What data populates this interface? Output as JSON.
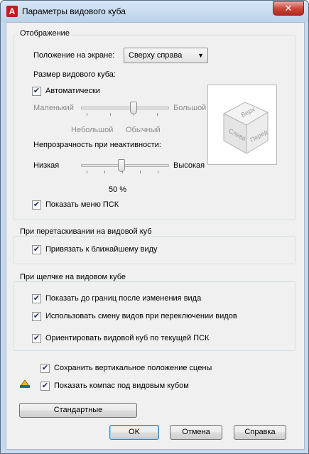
{
  "window": {
    "title": "Параметры видового куба",
    "app_icon_letter": "A",
    "close_glyph": "✕"
  },
  "display_group": {
    "title": "Отображение",
    "position_label": "Положение на экране:",
    "position_value": "Сверху справа",
    "size_label": "Размер видового куба:",
    "auto_label": "Автоматически",
    "auto_checked": true,
    "size_small": "Маленький",
    "size_large": "Большой",
    "size_smallish": "Небольшой",
    "size_normal": "Обычный",
    "size_level": 0.75,
    "opacity_label": "Непрозрачность при неактивности:",
    "opacity_low": "Низкая",
    "opacity_high": "Высокая",
    "opacity_value": "50 %",
    "opacity_level": 0.5,
    "show_ucs_menu_label": "Показать меню ПСК",
    "show_ucs_menu_checked": true,
    "cube_faces": {
      "top": "Верх",
      "left": "Слева",
      "front": "Перед"
    }
  },
  "drag_group": {
    "title": "При перетаскивании на видовой куб",
    "snap_label": "Привязать к ближайшему виду",
    "snap_checked": true
  },
  "click_group": {
    "title": "При щелчке на видовом кубе",
    "zoom_extents_label": "Показать до границ после изменения вида",
    "smooth_transition_label": "Использовать смену видов при переключении видов",
    "orient_label": "Ориентировать видовой куб по текущей ПСК",
    "checked": true
  },
  "bottom": {
    "keep_upright_label": "Сохранить вертикальное положение сцены",
    "show_compass_label": "Показать компас под видовым кубом",
    "defaults_button": "Стандартные",
    "ok_button": "OK",
    "cancel_button": "Отмена",
    "help_button": "Справка"
  },
  "check_glyph": "✔"
}
